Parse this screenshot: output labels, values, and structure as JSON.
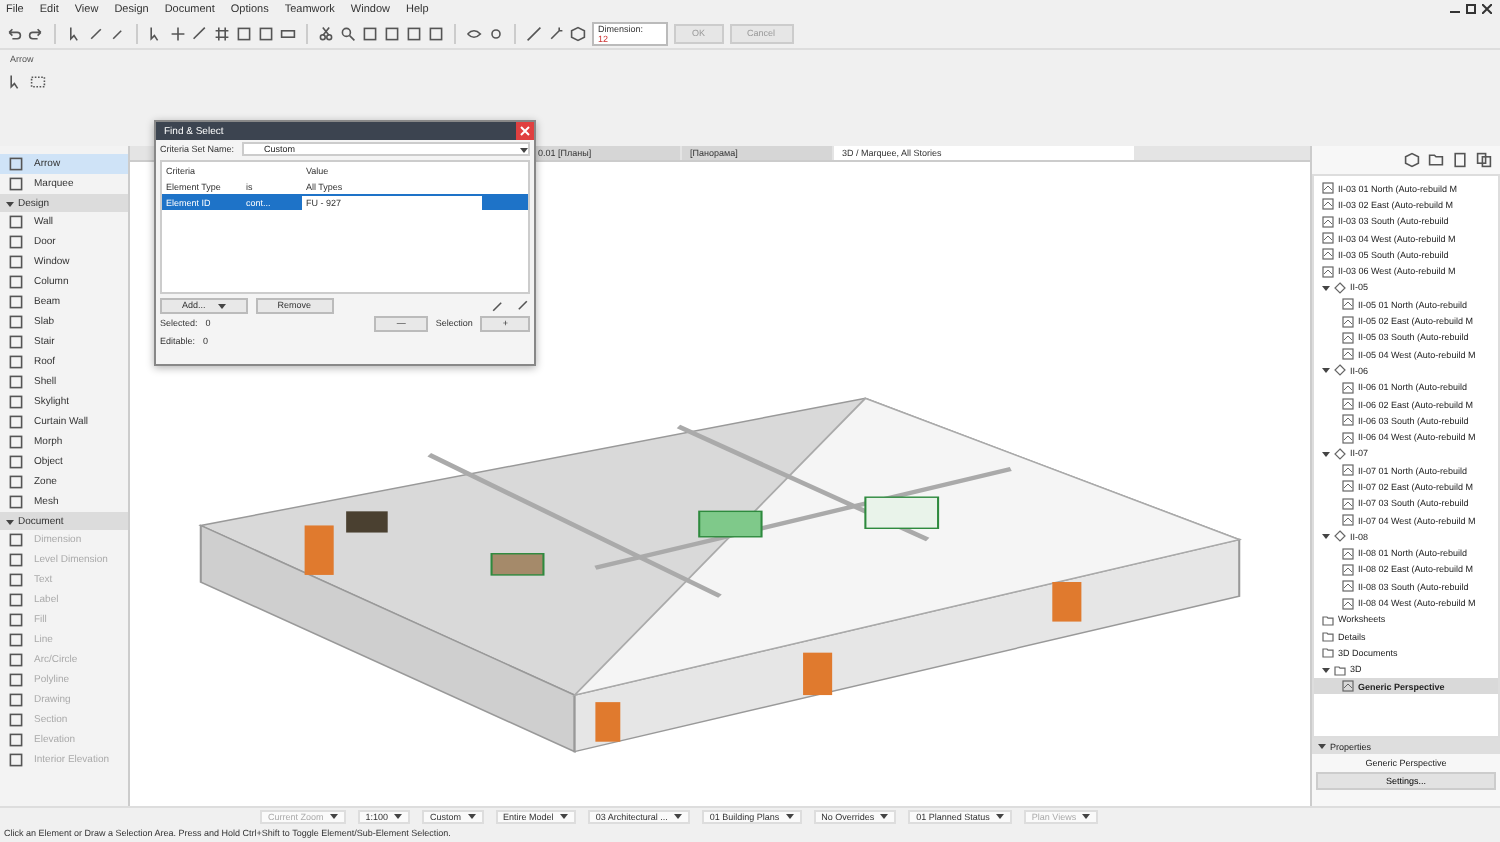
{
  "menu": [
    "File",
    "Edit",
    "View",
    "Design",
    "Document",
    "Options",
    "Teamwork",
    "Window",
    "Help"
  ],
  "info_label": "Arrow",
  "dimension": {
    "label": "Dimension:",
    "value": "12",
    "buttons": [
      "OK",
      "Cancel"
    ]
  },
  "toolbox": {
    "top": [
      {
        "label": "Arrow",
        "selected": true
      },
      {
        "label": "Marquee",
        "selected": false
      }
    ],
    "groups": [
      {
        "title": "Design",
        "expanded": true,
        "disabled": false,
        "items": [
          "Wall",
          "Door",
          "Window",
          "Column",
          "Beam",
          "Slab",
          "Stair",
          "Roof",
          "Shell",
          "Skylight",
          "Curtain Wall",
          "Morph",
          "Object",
          "Zone",
          "Mesh"
        ]
      },
      {
        "title": "Document",
        "expanded": true,
        "disabled": true,
        "items": [
          "Dimension",
          "Level Dimension",
          "Text",
          "Label",
          "Fill",
          "Line",
          "Arc/Circle",
          "Polyline",
          "Drawing",
          "Section",
          "Elevation",
          "Interior Elevation"
        ]
      }
    ]
  },
  "tabs": [
    {
      "label": "0.01 [Планы]",
      "selected": false
    },
    {
      "label": "[Панорама]",
      "selected": false
    },
    {
      "label": "3D / Marquee, All Stories",
      "selected": true
    }
  ],
  "find_select": {
    "title": "Find & Select",
    "criteria_set_label": "Criteria Set Name:",
    "criteria_set_value": "Custom",
    "columns": [
      "Criteria",
      "Value"
    ],
    "rows": [
      {
        "criteria": "Element Type",
        "operator": "is",
        "value": "All Types",
        "selected": false
      },
      {
        "criteria": "Element ID",
        "operator": "cont...",
        "value": "FU - 927",
        "selected": true
      }
    ],
    "add_button": "Add...",
    "remove_button": "Remove",
    "selected_label": "Selected:",
    "selected_count": "0",
    "editable_label": "Editable:",
    "editable_count": "0",
    "minus_button": "—",
    "selection_label": "Selection",
    "plus_button": "+"
  },
  "navigator": {
    "tree": [
      {
        "kind": "view",
        "label": "II-03 01 North (Auto-rebuild M",
        "selected": false
      },
      {
        "kind": "view",
        "label": "II-03 02 East (Auto-rebuild M",
        "selected": false
      },
      {
        "kind": "view",
        "label": "II-03 03 South (Auto-rebuild",
        "selected": false
      },
      {
        "kind": "view",
        "label": "II-03 04 West (Auto-rebuild M",
        "selected": false
      },
      {
        "kind": "view",
        "label": "II-03 05 South (Auto-rebuild",
        "selected": false
      },
      {
        "kind": "view",
        "label": "II-03 06 West (Auto-rebuild M",
        "selected": false
      },
      {
        "kind": "story",
        "label": "II-05",
        "expanded": true,
        "selected": false,
        "children": [
          {
            "kind": "view",
            "label": "II-05 01 North (Auto-rebuild",
            "selected": false
          },
          {
            "kind": "view",
            "label": "II-05 02 East (Auto-rebuild M",
            "selected": false
          },
          {
            "kind": "view",
            "label": "II-05 03 South (Auto-rebuild",
            "selected": false
          },
          {
            "kind": "view",
            "label": "II-05 04 West (Auto-rebuild M",
            "selected": false
          }
        ]
      },
      {
        "kind": "story",
        "label": "II-06",
        "expanded": true,
        "selected": false,
        "children": [
          {
            "kind": "view",
            "label": "II-06 01 North (Auto-rebuild",
            "selected": false
          },
          {
            "kind": "view",
            "label": "II-06 02 East (Auto-rebuild M",
            "selected": false
          },
          {
            "kind": "view",
            "label": "II-06 03 South (Auto-rebuild",
            "selected": false
          },
          {
            "kind": "view",
            "label": "II-06 04 West (Auto-rebuild M",
            "selected": false
          }
        ]
      },
      {
        "kind": "story",
        "label": "II-07",
        "expanded": true,
        "selected": false,
        "children": [
          {
            "kind": "view",
            "label": "II-07 01 North (Auto-rebuild",
            "selected": false
          },
          {
            "kind": "view",
            "label": "II-07 02 East (Auto-rebuild M",
            "selected": false
          },
          {
            "kind": "view",
            "label": "II-07 03 South (Auto-rebuild",
            "selected": false
          },
          {
            "kind": "view",
            "label": "II-07 04 West (Auto-rebuild M",
            "selected": false
          }
        ]
      },
      {
        "kind": "story",
        "label": "II-08",
        "expanded": true,
        "selected": false,
        "children": [
          {
            "kind": "view",
            "label": "II-08 01 North (Auto-rebuild",
            "selected": false
          },
          {
            "kind": "view",
            "label": "II-08 02 East (Auto-rebuild M",
            "selected": false
          },
          {
            "kind": "view",
            "label": "II-08 03 South (Auto-rebuild",
            "selected": false
          },
          {
            "kind": "view",
            "label": "II-08 04 West (Auto-rebuild M",
            "selected": false
          }
        ]
      },
      {
        "kind": "folder",
        "label": "Worksheets",
        "selected": false
      },
      {
        "kind": "folder",
        "label": "Details",
        "selected": false
      },
      {
        "kind": "folder",
        "label": "3D Documents",
        "selected": false
      },
      {
        "kind": "folder",
        "label": "3D",
        "expanded": true,
        "selected": false,
        "children": [
          {
            "kind": "view",
            "label": "Generic Perspective",
            "selected": true
          }
        ]
      }
    ],
    "properties": {
      "title": "Properties",
      "expanded": true,
      "name": "Generic Perspective",
      "button": "Settings..."
    }
  },
  "view_options": [
    {
      "label": "Current Zoom",
      "disabled": true
    },
    {
      "label": "1:100",
      "disabled": false
    },
    {
      "label": "Custom",
      "disabled": false
    },
    {
      "label": "Entire Model",
      "disabled": false
    },
    {
      "label": "03 Architectural ...",
      "disabled": false
    },
    {
      "label": "01 Building Plans",
      "disabled": false
    },
    {
      "label": "No Overrides",
      "disabled": false
    },
    {
      "label": "01 Planned Status",
      "disabled": false
    },
    {
      "label": "Plan Views",
      "disabled": true
    }
  ],
  "status_bar": "Click an Element or Draw a Selection Area. Press and Hold Ctrl+Shift to Toggle Element/Sub-Element Selection."
}
